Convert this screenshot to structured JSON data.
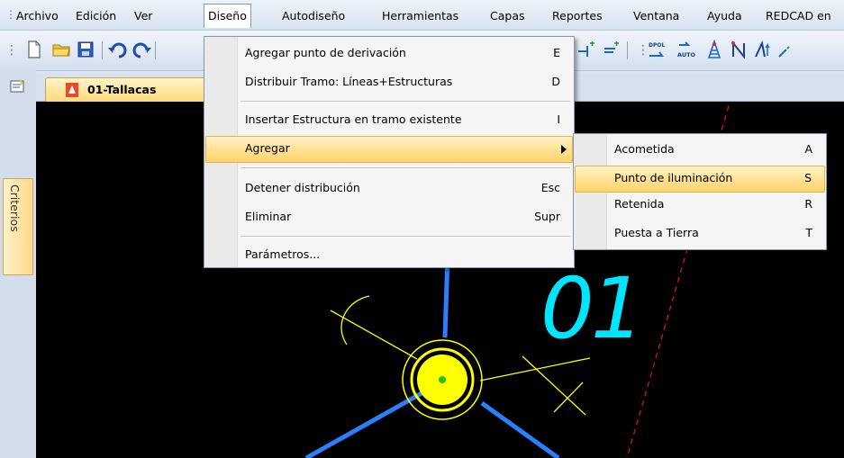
{
  "menubar": {
    "items": [
      "Archivo",
      "Edición",
      "Ver",
      "Diseño",
      "Autodiseño",
      "Herramientas",
      "Capas",
      "Reportes",
      "Ventana",
      "Ayuda",
      "REDCAD en"
    ],
    "active_index": 3
  },
  "document_tab": {
    "label": "01-Tallacas",
    "close": "×"
  },
  "side_panel": {
    "tab_label": "Criterios"
  },
  "canvas": {
    "label": "01"
  },
  "diseno_menu": {
    "items": [
      {
        "label": "Agregar punto de derivación",
        "shortcut": "E"
      },
      {
        "label": "Distribuir Tramo: Líneas+Estructuras",
        "shortcut": "D"
      },
      {
        "label": "Insertar Estructura en tramo existente",
        "shortcut": "I"
      },
      {
        "label": "Agregar",
        "shortcut": ""
      },
      {
        "label": "Detener distribución",
        "shortcut": "Esc"
      },
      {
        "label": "Eliminar",
        "shortcut": "Supr"
      },
      {
        "label": "Parámetros...",
        "shortcut": ""
      }
    ]
  },
  "agregar_submenu": {
    "items": [
      {
        "label": "Acometida",
        "shortcut": "A"
      },
      {
        "label": "Punto de iluminación",
        "shortcut": "S"
      },
      {
        "label": "Retenida",
        "shortcut": "R"
      },
      {
        "label": "Puesta a Tierra",
        "shortcut": "T"
      }
    ]
  },
  "colors": {
    "highlight": "#ffd36a",
    "canvas": "#000000",
    "label_cyan": "#00e5ff",
    "pole_yellow": "#ffff00",
    "line_blue": "#2a7fff"
  }
}
